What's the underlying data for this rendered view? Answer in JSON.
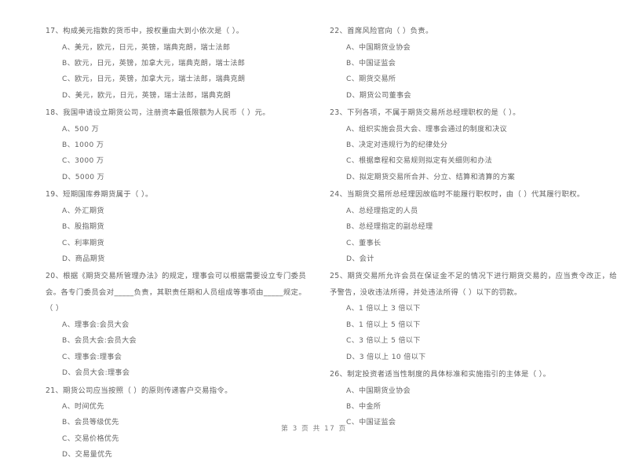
{
  "document": {
    "type": "scanned-exam-paper",
    "footer": "第 3 页 共 17 页",
    "ink_color": "#636363",
    "page_background": "#ffffff"
  },
  "left_column": {
    "questions": [
      {
        "number": "17",
        "stem": "17、构成美元指数的货币中，按权重由大到小依次是（          ）。",
        "options": [
          "A、美元，欧元，日元，英镑，瑞典克朗，瑞士法郎",
          "B、欧元，日元，英镑，加拿大元，瑞典克朗，瑞士法郎",
          "C、欧元，日元，英镑，加拿大元，瑞士法郎，瑞典克朗",
          "D、美元，欧元，日元，英镑，瑞士法郎，瑞典克朗"
        ]
      },
      {
        "number": "18",
        "stem": "18、我国申请设立期货公司，注册资本最低限额为人民币（          ）元。",
        "options": [
          "A、500 万",
          "B、1000 万",
          "C、3000 万",
          "D、5000 万"
        ]
      },
      {
        "number": "19",
        "stem": "19、短期国库券期货属于（          ）。",
        "options": [
          "A、外汇期货",
          "B、股指期货",
          "C、利率期货",
          "D、商品期货"
        ]
      },
      {
        "number": "20",
        "stem": "20、根据《期货交易所管理办法》的规定，理事会可以根据需要设立专门委员会。各专门委员会对_____负责，其职责任期和人员组成等事项由_____规定。（          ）",
        "options": [
          "A、理事会:会员大会",
          "B、会员大会:会员大会",
          "C、理事会:理事会",
          "D、会员大会:理事会"
        ]
      },
      {
        "number": "21",
        "stem": "21、期货公司应当按照（          ）的原则传递客户交易指令。",
        "options": [
          "A、时间优先",
          "B、会员等级优先",
          "C、交易价格优先",
          "D、交易量优先"
        ]
      }
    ]
  },
  "right_column": {
    "questions": [
      {
        "number": "22",
        "stem": "22、首席风险官向（          ）负责。",
        "options": [
          "A、中国期货业协会",
          "B、中国证监会",
          "C、期货交易所",
          "D、期货公司董事会"
        ]
      },
      {
        "number": "23",
        "stem": "23、下列各项，不属于期货交易所总经理职权的是（          ）。",
        "options": [
          "A、组织实施会员大会、理事会通过的制度和决议",
          "B、决定对违规行为的纪律处分",
          "C、根据章程和交易规则拟定有关细则和办法",
          "D、拟定期货交易所合并、分立、结算和清算的方案"
        ]
      },
      {
        "number": "24",
        "stem": "24、当期货交易所总经理因故临时不能履行职权时，由（          ）代其履行职权。",
        "options": [
          "A、总经理指定的人员",
          "B、总经理指定的副总经理",
          "C、董事长",
          "D、会计"
        ]
      },
      {
        "number": "25",
        "stem": "25、期货交易所允许会员在保证金不足的情况下进行期货交易的，应当责令改正，给予警告，没收违法所得，并处违法所得（          ）以下的罚款。",
        "options": [
          "A、1 倍以上 3 倍以下",
          "B、1 倍以上 5 倍以下",
          "C、3 倍以上 5 倍以下",
          "D、3 倍以上 10 倍以下"
        ]
      },
      {
        "number": "26",
        "stem": "26、制定投资者适当性制度的具体标准和实施指引的主体是（          ）。",
        "options": [
          "A、中国期货业协会",
          "B、中金所",
          "C、中国证监会"
        ]
      }
    ]
  }
}
